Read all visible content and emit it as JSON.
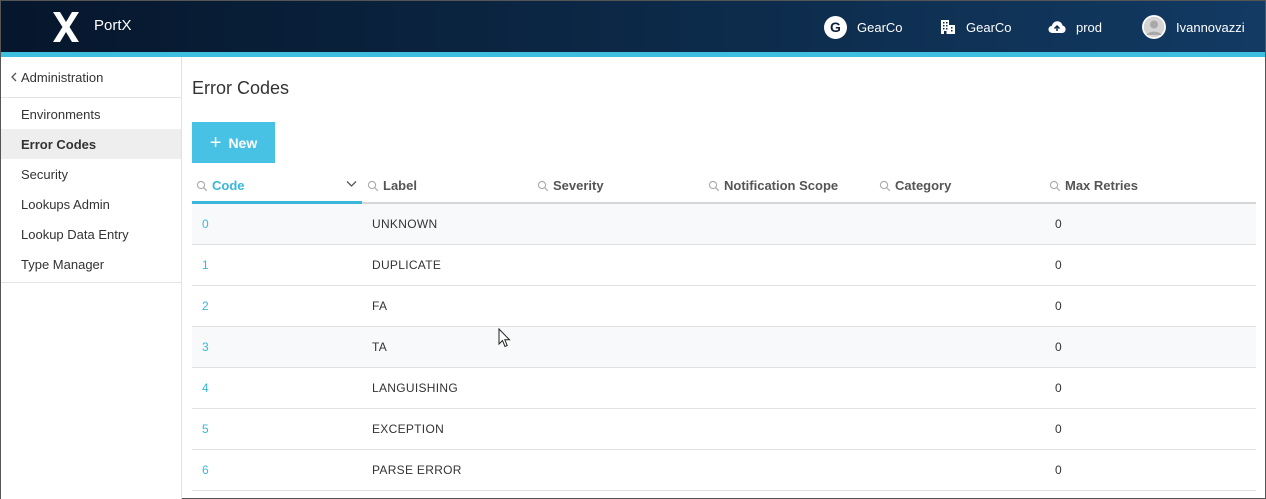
{
  "header": {
    "brand": "PortX",
    "org_initial": "G",
    "org_label": "GearCo",
    "tenant_label": "GearCo",
    "environment_label": "prod",
    "user_label": "Ivannovazzi"
  },
  "sidebar": {
    "back_label": "Administration",
    "items": [
      {
        "label": "Environments"
      },
      {
        "label": "Error Codes"
      },
      {
        "label": "Security"
      },
      {
        "label": "Lookups Admin"
      },
      {
        "label": "Lookup Data Entry"
      },
      {
        "label": "Type Manager"
      }
    ],
    "active_index": 1
  },
  "main": {
    "title": "Error Codes",
    "new_button_label": "New"
  },
  "table": {
    "columns": [
      "Code",
      "Label",
      "Severity",
      "Notification Scope",
      "Category",
      "Max Retries"
    ],
    "rows": [
      {
        "code": "0",
        "label": "UNKNOWN",
        "max_retries": "0"
      },
      {
        "code": "1",
        "label": "DUPLICATE",
        "max_retries": "0"
      },
      {
        "code": "2",
        "label": "FA",
        "max_retries": "0"
      },
      {
        "code": "3",
        "label": "TA",
        "max_retries": "0"
      },
      {
        "code": "4",
        "label": "LANGUISHING",
        "max_retries": "0"
      },
      {
        "code": "5",
        "label": "EXCEPTION",
        "max_retries": "0"
      },
      {
        "code": "6",
        "label": "PARSE ERROR",
        "max_retries": "0"
      }
    ]
  },
  "colors": {
    "accent": "#3ab7da",
    "button": "#47c1e4",
    "header_dark": "#0b1f3a"
  }
}
